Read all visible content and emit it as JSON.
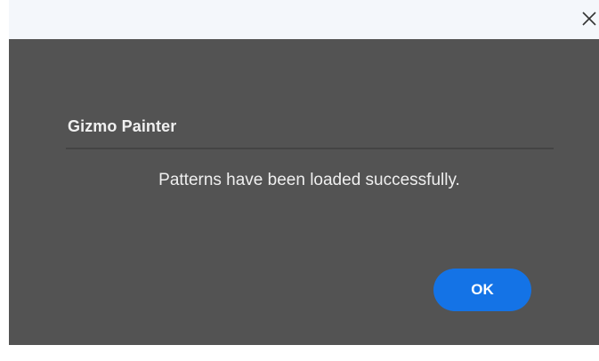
{
  "window": {
    "close_icon": "close-icon"
  },
  "dialog": {
    "title": "Gizmo Painter",
    "message": "Patterns have been loaded successfully.",
    "ok_label": "OK"
  },
  "colors": {
    "panel_background": "#535353",
    "accent": "#1473e6",
    "titlebar": "#f4f7fb"
  }
}
